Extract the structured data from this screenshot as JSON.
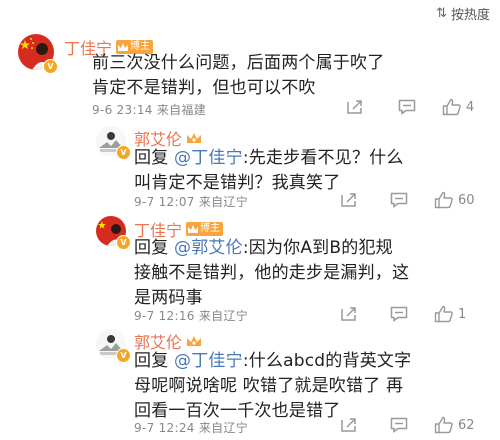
{
  "sort_label": "按热度",
  "comments": [
    {
      "author": "丁佳宁",
      "badge": "博主",
      "text_lines": [
        "前三次没什么问题，后面两个属于吹了",
        "肯定不是错判，但也可以不吹"
      ],
      "time": "9-6 23:14",
      "source": "来自福建",
      "likes": "4"
    },
    {
      "author": "郭艾伦",
      "reply_prefix": "回复",
      "reply_to": "@丁佳宁",
      "text_first": ":先走步看不见？什么",
      "text_lines": [
        "叫肯定不是错判？我真笑了"
      ],
      "time": "9-7 12:07",
      "source": "来自辽宁",
      "likes": "60"
    },
    {
      "author": "丁佳宁",
      "badge": "博主",
      "reply_prefix": "回复",
      "reply_to": "@郭艾伦",
      "text_first": ":因为你A到B的犯规",
      "text_lines": [
        "接触不是错判，他的走步是漏判，这",
        "是两码事"
      ],
      "time": "9-7 12:16",
      "source": "来自辽宁",
      "likes": "1"
    },
    {
      "author": "郭艾伦",
      "reply_prefix": "回复",
      "reply_to": "@丁佳宁",
      "text_first": ":什么abcd的背英文字",
      "text_lines": [
        "母呢啊说啥呢 吹错了就是吹错了 再",
        "回看一百次一千次也是错了"
      ],
      "time": "9-7 12:24",
      "source": "来自辽宁",
      "likes": "62"
    }
  ],
  "colors": {
    "name": "#eb7350",
    "mention": "#4a78b8",
    "badge": "#f9a43c",
    "meta": "#888888"
  },
  "icons": [
    "sort-icon",
    "share-icon",
    "reply-icon",
    "like-icon",
    "crown-icon"
  ]
}
